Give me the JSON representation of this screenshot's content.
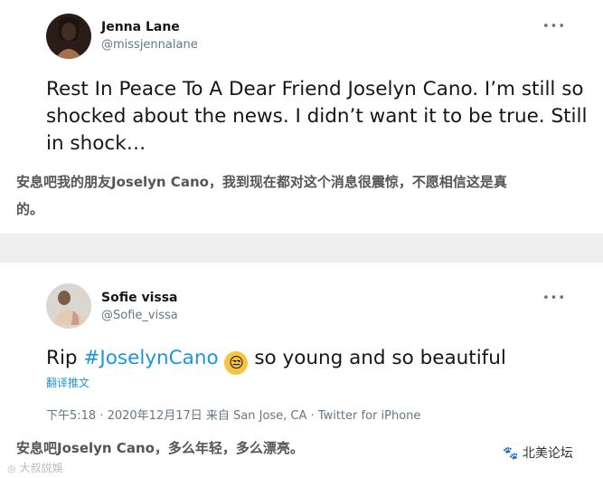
{
  "tweet1": {
    "name": "Jenna Lane",
    "handle": "@missjennalane",
    "more": "•••",
    "text_line1": "Rest In Peace To A Dear Friend Joselyn Cano. I’m still so",
    "text_line2": "shocked about the news. I didn’t want it to be true. Still",
    "text_line3": "in shock…",
    "zh_line1": "安息吧我的朋友Joselyn Cano，我到现在都对这个消息很震惊，不愿相信这是真",
    "zh_line2": "的。"
  },
  "tweet2": {
    "name": "Sofie vissa",
    "handle": "@Sofie_vissa",
    "more": "•••",
    "text_prefix": "Rip ",
    "hashtag": "#JoselynCano",
    "emoji": "😒",
    "text_suffix": " so young and so beautiful",
    "translate": "翻译推文",
    "meta": "下午5:18 · 2020年12月17日 来自 San Jose, CA · Twitter for iPhone",
    "zh_line": "安息吧Joselyn Cano，多么年轻，多么漂亮。"
  },
  "watermark": {
    "left": "大叔説娛",
    "right_icon": "🐾",
    "right_text": "北美论坛"
  }
}
